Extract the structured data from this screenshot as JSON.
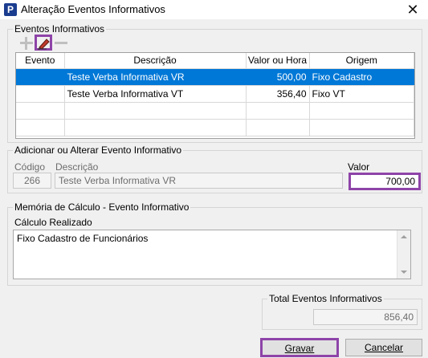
{
  "window": {
    "title": "Alteração Eventos Informativos",
    "app_icon": "P",
    "close_glyph": "✕"
  },
  "events_group": {
    "legend": "Eventos Informativos",
    "columns": [
      "Evento",
      "Descrição",
      "Valor ou Hora",
      "Origem"
    ],
    "rows": [
      {
        "evento": "",
        "descricao": "Teste Verba Informativa VR",
        "valor": "500,00",
        "origem": "Fixo Cadastro",
        "selected": true
      },
      {
        "evento": "",
        "descricao": "Teste Verba Informativa VT",
        "valor": "356,40",
        "origem": "Fixo VT",
        "selected": false
      }
    ]
  },
  "edit_group": {
    "legend": "Adicionar ou Alterar Evento Informativo",
    "codigo_label": "Código",
    "codigo_value": "266",
    "descricao_label": "Descrição",
    "descricao_value": "Teste Verba Informativa VR",
    "valor_label": "Valor",
    "valor_value": "700,00"
  },
  "memo_group": {
    "legend": "Memória de Cálculo - Evento Informativo",
    "label": "Cálculo Realizado",
    "text": "Fixo Cadastro de Funcionários"
  },
  "total_group": {
    "legend": "Total Eventos Informativos",
    "value": "856,40"
  },
  "buttons": {
    "gravar": "Gravar",
    "cancelar": "Cancelar"
  },
  "colors": {
    "selection": "#0078d7",
    "highlight": "#8e44a8"
  }
}
